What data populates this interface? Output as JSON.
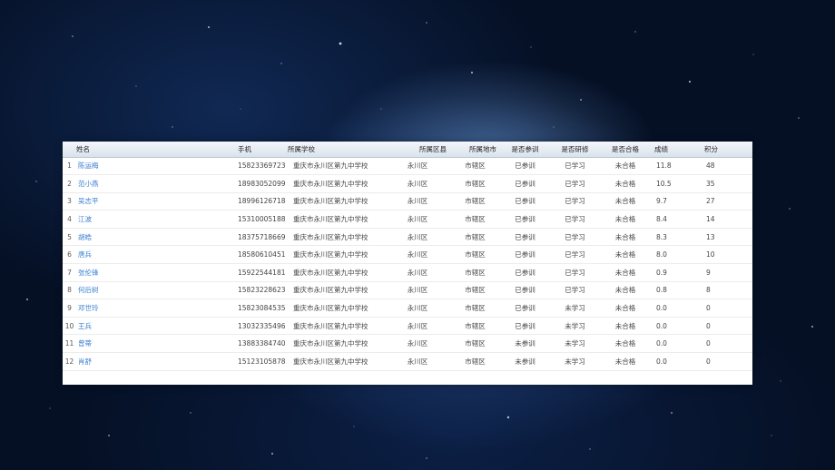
{
  "table": {
    "headers": {
      "name": "姓名",
      "phone": "手机",
      "school": "所属学校",
      "district": "所属区县",
      "city": "所属地市",
      "trained": "是否参训",
      "studied": "是否研修",
      "qualified": "是否合格",
      "score": "成绩",
      "points": "积分"
    },
    "rows": [
      {
        "no": "1",
        "name": "陈运梅",
        "phone": "15823369723",
        "school": "重庆市永川区第九中学校",
        "district": "永川区",
        "city": "市辖区",
        "trained": "已参训",
        "studied": "已学习",
        "qualified": "未合格",
        "score": "11.8",
        "points": "48"
      },
      {
        "no": "2",
        "name": "范小燕",
        "phone": "18983052099",
        "school": "重庆市永川区第九中学校",
        "district": "永川区",
        "city": "市辖区",
        "trained": "已参训",
        "studied": "已学习",
        "qualified": "未合格",
        "score": "10.5",
        "points": "35"
      },
      {
        "no": "3",
        "name": "吴志平",
        "phone": "18996126718",
        "school": "重庆市永川区第九中学校",
        "district": "永川区",
        "city": "市辖区",
        "trained": "已参训",
        "studied": "已学习",
        "qualified": "未合格",
        "score": "9.7",
        "points": "27"
      },
      {
        "no": "4",
        "name": "江波",
        "phone": "15310005188",
        "school": "重庆市永川区第九中学校",
        "district": "永川区",
        "city": "市辖区",
        "trained": "已参训",
        "studied": "已学习",
        "qualified": "未合格",
        "score": "8.4",
        "points": "14"
      },
      {
        "no": "5",
        "name": "胡皓",
        "phone": "18375718669",
        "school": "重庆市永川区第九中学校",
        "district": "永川区",
        "city": "市辖区",
        "trained": "已参训",
        "studied": "已学习",
        "qualified": "未合格",
        "score": "8.3",
        "points": "13"
      },
      {
        "no": "6",
        "name": "唐兵",
        "phone": "18580610451",
        "school": "重庆市永川区第九中学校",
        "district": "永川区",
        "city": "市辖区",
        "trained": "已参训",
        "studied": "已学习",
        "qualified": "未合格",
        "score": "8.0",
        "points": "10"
      },
      {
        "no": "7",
        "name": "张伦锋",
        "phone": "15922544181",
        "school": "重庆市永川区第九中学校",
        "district": "永川区",
        "city": "市辖区",
        "trained": "已参训",
        "studied": "已学习",
        "qualified": "未合格",
        "score": "0.9",
        "points": "9"
      },
      {
        "no": "8",
        "name": "何后树",
        "phone": "15823228623",
        "school": "重庆市永川区第九中学校",
        "district": "永川区",
        "city": "市辖区",
        "trained": "已参训",
        "studied": "已学习",
        "qualified": "未合格",
        "score": "0.8",
        "points": "8"
      },
      {
        "no": "9",
        "name": "邓世玲",
        "phone": "15823084535",
        "school": "重庆市永川区第九中学校",
        "district": "永川区",
        "city": "市辖区",
        "trained": "已参训",
        "studied": "未学习",
        "qualified": "未合格",
        "score": "0.0",
        "points": "0"
      },
      {
        "no": "10",
        "name": "王兵",
        "phone": "13032335496",
        "school": "重庆市永川区第九中学校",
        "district": "永川区",
        "city": "市辖区",
        "trained": "已参训",
        "studied": "未学习",
        "qualified": "未合格",
        "score": "0.0",
        "points": "0"
      },
      {
        "no": "11",
        "name": "曾蒂",
        "phone": "13883384740",
        "school": "重庆市永川区第九中学校",
        "district": "永川区",
        "city": "市辖区",
        "trained": "未参训",
        "studied": "未学习",
        "qualified": "未合格",
        "score": "0.0",
        "points": "0"
      },
      {
        "no": "12",
        "name": "肖舒",
        "phone": "15123105878",
        "school": "重庆市永川区第九中学校",
        "district": "永川区",
        "city": "市辖区",
        "trained": "未参训",
        "studied": "未学习",
        "qualified": "未合格",
        "score": "0.0",
        "points": "0"
      }
    ]
  }
}
